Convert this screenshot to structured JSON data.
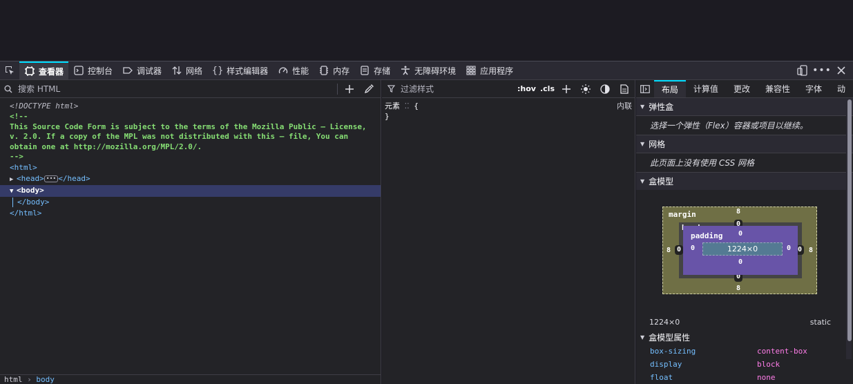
{
  "toolbar": {
    "tabs": [
      {
        "label": "查看器",
        "icon": "inspector-icon"
      },
      {
        "label": "控制台",
        "icon": "console-icon"
      },
      {
        "label": "调试器",
        "icon": "debugger-icon"
      },
      {
        "label": "网络",
        "icon": "network-icon"
      },
      {
        "label": "样式编辑器",
        "icon": "style-editor-icon"
      },
      {
        "label": "性能",
        "icon": "performance-icon"
      },
      {
        "label": "内存",
        "icon": "memory-icon"
      },
      {
        "label": "存储",
        "icon": "storage-icon"
      },
      {
        "label": "无障碍环境",
        "icon": "accessibility-icon"
      },
      {
        "label": "应用程序",
        "icon": "application-icon"
      }
    ]
  },
  "markup": {
    "search_placeholder": "搜索 HTML",
    "doctype": "<!DOCTYPE html>",
    "comment_open": "<!--",
    "comment_text": "This Source Code Form is subject to the terms of the Mozilla Public – License, v. 2.0. If a copy of the MPL was not distributed with this – file, You can obtain one at http://mozilla.org/MPL/2.0/.",
    "comment_close": "-->",
    "html_open": "<html>",
    "head_open": "<head>",
    "head_close": "</head>",
    "body_open": "<body>",
    "body_close": "</body>",
    "html_close": "</html>",
    "breadcrumb": [
      "html",
      "body"
    ]
  },
  "rules": {
    "filter_placeholder": "过滤样式",
    "hov": ":hov",
    "cls": ".cls",
    "element_selector": "元素",
    "open_brace": "{",
    "close_brace": "}",
    "source": "内联"
  },
  "layout": {
    "tabs": [
      "布局",
      "计算值",
      "更改",
      "兼容性",
      "字体",
      "动"
    ],
    "flexbox_title": "弹性盒",
    "flexbox_msg": "选择一个弹性（Flex）容器或项目以继续。",
    "grid_title": "网格",
    "grid_msg": "此页面上没有使用 CSS 网格",
    "boxmodel_title": "盒模型",
    "box": {
      "margin_label": "margin",
      "border_label": "border",
      "padding_label": "padding",
      "content": "1224×0",
      "margin_top": "8",
      "margin_bottom": "8",
      "margin_left": "8",
      "margin_right": "8",
      "border_top": "0",
      "border_bottom": "0",
      "border_left": "0",
      "border_right": "0",
      "padding_top": "0",
      "padding_bottom": "0",
      "padding_left": "0",
      "padding_right": "0"
    },
    "dims": "1224×0",
    "position": "static",
    "props_title": "盒模型属性",
    "props": [
      {
        "name": "box-sizing",
        "value": "content-box"
      },
      {
        "name": "display",
        "value": "block"
      },
      {
        "name": "float",
        "value": "none"
      }
    ]
  },
  "colors": {
    "accent": "#00ddff",
    "selection": "#353b68"
  }
}
